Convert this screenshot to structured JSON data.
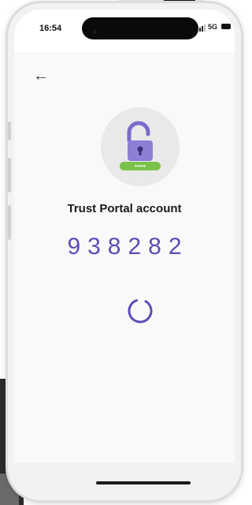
{
  "status_bar": {
    "time": "16:54",
    "network": "5G"
  },
  "icons": {
    "back": "back-arrow-icon",
    "lock": "open-padlock-icon",
    "password_pill": "password-pill-icon",
    "spinner": "loading-spinner-icon"
  },
  "colors": {
    "accent": "#5c4db8",
    "lock_purple": "#8c7fd6",
    "pill_green": "#7bc24b"
  },
  "main": {
    "account_label": "Trust Portal account",
    "code": "938282",
    "password_mask": "•••••"
  }
}
